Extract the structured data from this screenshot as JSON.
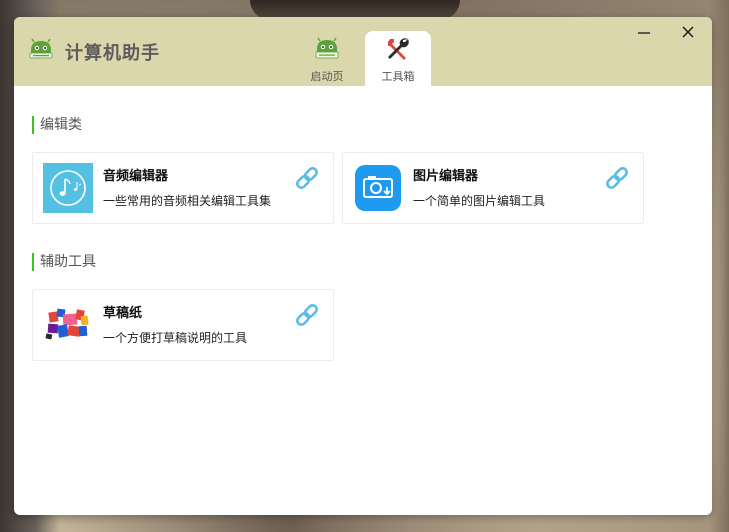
{
  "app": {
    "title": "计算机助手"
  },
  "tabs": [
    {
      "label": "启动页",
      "icon": "android-logo-icon",
      "active": false
    },
    {
      "label": "工具箱",
      "icon": "tools-icon",
      "active": true
    }
  ],
  "window_controls": {
    "minimize_icon": "minimize-icon",
    "close_icon": "close-icon"
  },
  "sections": [
    {
      "title": "编辑类",
      "tools": [
        {
          "name": "音频编辑器",
          "desc": "一些常用的音频相关编辑工具集",
          "icon": "music-note-icon",
          "link_icon": "link-icon"
        },
        {
          "name": "图片编辑器",
          "desc": "一个简单的图片编辑工具",
          "icon": "camera-icon",
          "link_icon": "link-icon"
        }
      ]
    },
    {
      "title": "辅助工具",
      "tools": [
        {
          "name": "草稿纸",
          "desc": "一个方便打草稿说明的工具",
          "icon": "draft-paper-icon",
          "link_icon": "link-icon"
        }
      ]
    }
  ],
  "colors": {
    "titlebar_bg": "#dbd7ad",
    "section_accent": "#3cc31f",
    "audio_icon_bg": "#55c1e2",
    "image_icon_bg": "#1e9bf0",
    "link_icon": "#59bde7"
  }
}
